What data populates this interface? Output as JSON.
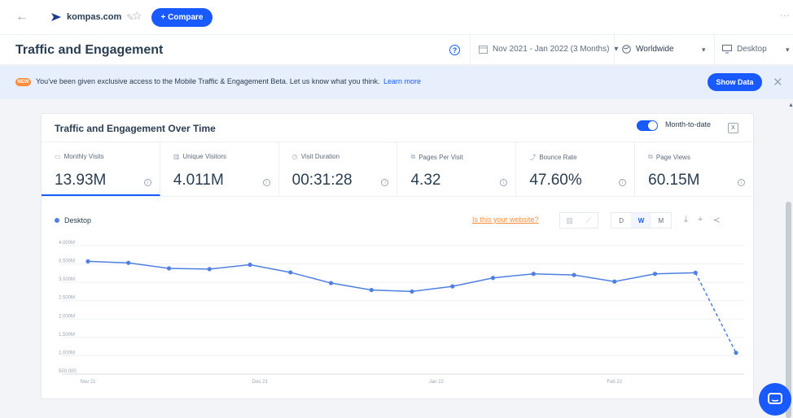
{
  "topbar": {
    "domain": "kompas.com",
    "compare_label": "+ Compare"
  },
  "header": {
    "title": "Traffic and Engagement",
    "date_range": "Nov 2021 - Jan 2022 (3 Months)",
    "region": "Worldwide",
    "device": "Desktop"
  },
  "banner": {
    "badge": "NEW",
    "text": "You've been given exclusive access to the Mobile Traffic & Engagement Beta.  Let us know what you think.",
    "link": "Learn more",
    "button": "Show Data"
  },
  "card": {
    "title": "Traffic and Engagement Over Time",
    "toggle_label": "Month-to-date",
    "metrics": [
      {
        "label": "Monthly Visits",
        "value": "13.93M"
      },
      {
        "label": "Unique Visitors",
        "value": "4.011M"
      },
      {
        "label": "Visit Duration",
        "value": "00:31:28"
      },
      {
        "label": "Pages Per Visit",
        "value": "4.32"
      },
      {
        "label": "Bounce Rate",
        "value": "47.60%"
      },
      {
        "label": "Page Views",
        "value": "60.15M"
      }
    ],
    "legend": "Desktop",
    "site_link": "Is this your website?",
    "granularity": [
      "D",
      "W",
      "M"
    ],
    "granularity_selected": "W"
  },
  "chart_data": {
    "type": "line",
    "series": [
      {
        "name": "Desktop",
        "color": "#4f80e1",
        "values": [
          3570000,
          3530000,
          3380000,
          3360000,
          3480000,
          3270000,
          2980000,
          2790000,
          2750000,
          2890000,
          3120000,
          3230000,
          3200000,
          3020000,
          3230000,
          3260000,
          1080000
        ],
        "dashed_last_segment": true
      }
    ],
    "y_ticks": [
      "500,000",
      "1.000M",
      "1.500M",
      "2.000M",
      "2.500M",
      "3.000M",
      "3.500M",
      "4.000M"
    ],
    "ylim": [
      500000,
      4000000
    ],
    "x_ticks": [
      "Nov 21",
      "Dec 21",
      "Jan 22",
      "Feb 22"
    ],
    "x_tick_positions": [
      0,
      4.25,
      8.6,
      13.0
    ],
    "grid": true
  }
}
